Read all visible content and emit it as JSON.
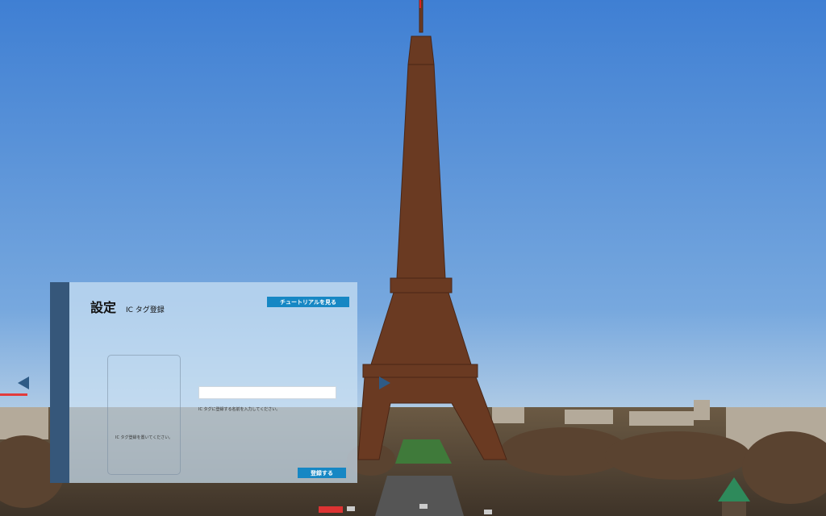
{
  "settings_panel": {
    "title": "設定",
    "subtitle": "IC タグ登録",
    "tutorial_button": "チュートリアルを見る",
    "drop_zone_label": "IC タグ登録を置いてください。",
    "name_input": {
      "value": "",
      "placeholder": ""
    },
    "name_input_hint": "IC タグに登録する名前を入力してください。",
    "register_button": "登録する"
  },
  "navigation": {
    "prev_icon": "arrow-left-icon",
    "next_icon": "arrow-right-icon"
  },
  "colors": {
    "accent": "#1687c4",
    "panel_strip": "#36577a",
    "nav_arrow": "#2e5b86"
  }
}
